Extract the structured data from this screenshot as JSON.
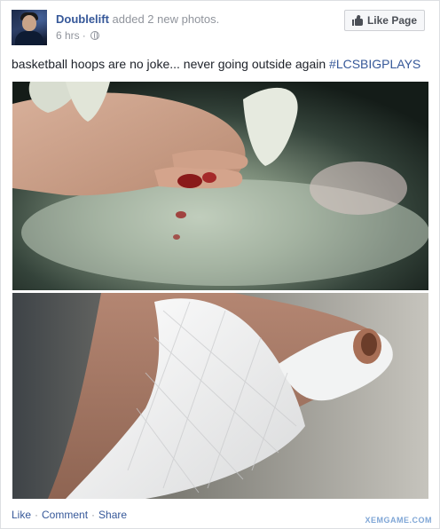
{
  "post": {
    "author": "Doublelift",
    "action": " added 2 new photos.",
    "time": "6 hrs",
    "time_separator": "·",
    "like_page_label": "Like Page",
    "caption_text": "basketball hoops are no joke... never going outside again ",
    "hashtag": "#LCSBIGPLAYS"
  },
  "footer": {
    "like": "Like",
    "comment": "Comment",
    "share": "Share",
    "sep": "·"
  },
  "watermark": "XEMGAME.COM",
  "colors": {
    "link": "#365899",
    "meta": "#90949c",
    "text": "#1d2129"
  }
}
